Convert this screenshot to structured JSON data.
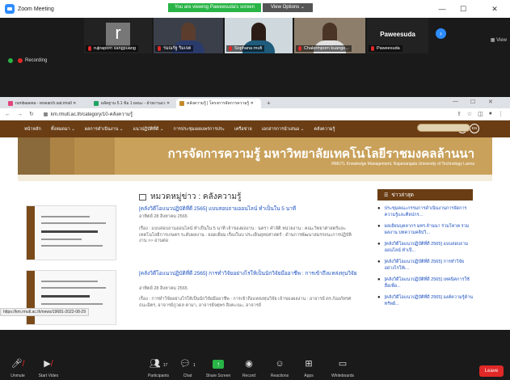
{
  "zoom": {
    "window_title": "Zoom Meeting",
    "viewing_banner": "You are viewing Paweesuda's screen",
    "view_options": "View Options ⌄",
    "view_label": "View",
    "recording": "Recording",
    "participants_tiles": [
      {
        "name": "rujiraporn sangpuang",
        "initial": "r"
      },
      {
        "name": "รมณรัฐ ริมเจต"
      },
      {
        "name": "Sophana rnufi"
      },
      {
        "name": "Chalermporn kuange..."
      },
      {
        "name": "Paweesuda",
        "big_name": "Paweesuda"
      }
    ],
    "toolbar": {
      "unmute": "Unmute",
      "start_video": "Start Video",
      "participants": "Participants",
      "participants_count": "17",
      "chat": "Chat",
      "chat_count": "1",
      "share_screen": "Share Screen",
      "record": "Record",
      "reactions": "Reactions",
      "apps": "Apps",
      "whiteboards": "Whiteboards",
      "leave": "Leave"
    }
  },
  "browser": {
    "tabs": [
      {
        "label": "rumbaaeea - research.sat.rmutl ✕",
        "icon_color": "#e0457b"
      },
      {
        "label": "ผลัดฐาน 5.1 ข้อ 1 ผลนะ - ฝ่ายงานอว ✕",
        "icon_color": "#1fa463"
      },
      {
        "label": "คลังความรู้ | โครงการจัดการความรู้ ✕",
        "icon_color": "#c48a2c"
      }
    ],
    "new_tab": "+",
    "url": "km.rmutl.ac.th/category/10-คลังความรู้",
    "status_url": "https://km.rmutl.ac.th/news/19681-2022-08-29"
  },
  "site": {
    "menu": [
      "หน้าหลัก",
      "ทั้งหมดมา ⌄",
      "ผลการดำเนินงาน ⌄",
      "แนวปฏิบัติที่ดี ⌄",
      "การประชุมเผยแพร่การประ",
      "เครือข่าย",
      "เอกสารการนำเสนอ ⌄",
      "คลังความรู้"
    ],
    "lang_th": "TH",
    "lang_en": "EN",
    "banner_title": "การจัดการความรู้ มหาวิทยาลัยเทคโนโลยีราชมงคลล้านนา",
    "banner_subtitle": "RMUTL Knowledge Management, Rajamangala University of Technology Lanna",
    "category_heading": "หมวดหมู่ข่าว : คลังความรู้",
    "posts": [
      {
        "title": "[คลังวิดีโอแนวปฏิบัติที่ดี 2565] แบบสอบถามออนไลน์ ทำเป็นใน 5 นาที",
        "date": "อาทิตย์ 28 สิงหาคม 2565",
        "excerpt": "เรื่อง : แบบสอบถามออนไลน์ ทำเป็นใน 5 นาที เจ้าของผลงาน : นครา คำจัติ หน่วยงาน : คณะวิทยาศาสตร์และเทคโนโลยีการเกษตร ระดับผลงาน : ยอดเยี่ยม เรื่องในบ ประเด็นยุทธศาสตร์ : ด้านการพัฒนาสมรรถนะการปฏิบัติงาน >> อ่านต่อ"
      },
      {
        "title": "[คลังวิดีโอแนวปฏิบัติที่ดี 2565] การทำวิจัยอย่างไรให้เป็นนักวิจัยมืออาชีพ : การเข้าถึงแหล่งทุนวิจัย",
        "date": "อาทิตย์ 28 สิงหาคม 2565",
        "excerpt": "เรื่อง : การทำวิจัยอย่างไรให้เป็นนักวิจัยมืออาชีพ : การเข้าถึงแหล่งทุนวิจัย เจ้าของผลงาน : อาจารย์ ดร.ก้องภัทรศ ธนะมิตร, อาจารย์ภูวดล คามา, อาจารย์จตุพร สิงคะเนะ, อาจารย์"
      }
    ],
    "sidebar": {
      "heading": "ข่าวล่าสุด",
      "items": [
        "ประชุมคณะกรรมการดำเนินงานการจัดการความรู้และศิลปกร...",
        "ผลเอียนบุคลากร มทร.ล้านนา ร่วมโหวต รวมผลงาน บทความคลิปวิ...",
        "[คลังวิดีโอแนวปฏิบัติที่ดี 2565] แบบสอบถามออนไลน์ ทำเป็...",
        "[คลังวิดีโอแนวปฏิบัติที่ดี 2565] การทำวิจัยอย่างไรให้เ...",
        "[คลังวิดีโอแนวปฏิบัติที่ดี 2565] เทคนิคการใช้สื่อเพื่อ...",
        "[คลังวิดีโอแนวปฏิบัติที่ดี 2565] องค์ความรู้ด้านทรัพย์..."
      ]
    },
    "thumb_captions": [
      "แบบสอบถามออนไลน์ ทำเป็นใน 5 นาที",
      "การทำวิจัยอย่างไรให้เป็นนักวิจัยมืออาชีพ"
    ]
  },
  "colors": {
    "brand_brown": "#6a3d14",
    "banner_gold": "#c9a15b",
    "zoom_blue": "#2d8cff",
    "zoom_green": "#28b446",
    "leave_red": "#e02828",
    "link_blue": "#1a4fbf"
  }
}
